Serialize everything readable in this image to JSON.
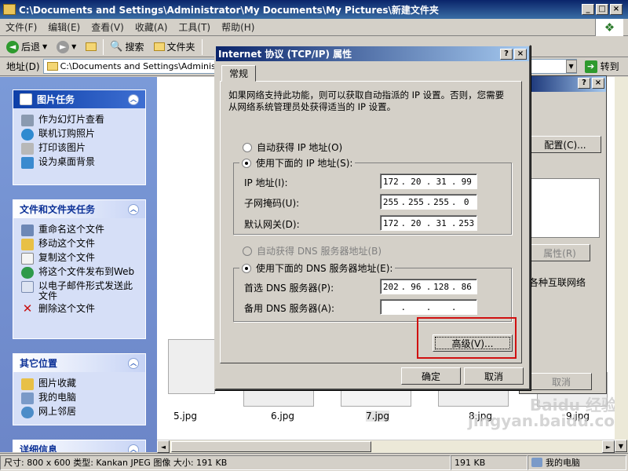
{
  "window": {
    "title": "C:\\Documents and Settings\\Administrator\\My Documents\\My Pictures\\新建文件夹"
  },
  "menu": [
    "文件(F)",
    "编辑(E)",
    "查看(V)",
    "收藏(A)",
    "工具(T)",
    "帮助(H)"
  ],
  "toolbar": {
    "back": "后退",
    "search": "搜索",
    "folders": "文件夹"
  },
  "address": {
    "label": "地址(D)",
    "value": "C:\\Documents and Settings\\Administrator",
    "go": "转到"
  },
  "left": {
    "picture_tasks": {
      "title": "图片任务",
      "items": [
        "作为幻灯片查看",
        "联机订购照片",
        "打印该图片",
        "设为桌面背景"
      ]
    },
    "file_tasks": {
      "title": "文件和文件夹任务",
      "items": [
        "重命名这个文件",
        "移动这个文件",
        "复制这个文件",
        "将这个文件发布到Web",
        "以电子邮件形式发送此文件",
        "删除这个文件"
      ]
    },
    "other_places": {
      "title": "其它位置",
      "items": [
        "图片收藏",
        "我的电脑",
        "网上邻居"
      ]
    },
    "details": {
      "title": "详细信息"
    }
  },
  "files": [
    "5.jpg",
    "6.jpg",
    "7.jpg",
    "8.jpg",
    "9.jpg"
  ],
  "status": {
    "info": "尺寸: 800 x 600 类型: Kankan JPEG 图像 大小: 191 KB",
    "size": "191 KB",
    "location": "我的电脑"
  },
  "back_dialog": {
    "config": "配置(C)...",
    "properties": "属性(R)",
    "text": "各种互联网络",
    "cancel": "取消"
  },
  "dialog": {
    "title": "Internet 协议 (TCP/IP) 属性",
    "tab": "常规",
    "description": "如果网络支持此功能，则可以获取自动指派的 IP 设置。否则，您需要从网络系统管理员处获得适当的 IP 设置。",
    "auto_ip": "自动获得 IP 地址(O)",
    "manual_ip": "使用下面的 IP 地址(S):",
    "ip_label": "IP 地址(I):",
    "ip": [
      "172",
      "20",
      "31",
      "99"
    ],
    "mask_label": "子网掩码(U):",
    "mask": [
      "255",
      "255",
      "255",
      "0"
    ],
    "gateway_label": "默认网关(D):",
    "gateway": [
      "172",
      "20",
      "31",
      "253"
    ],
    "auto_dns": "自动获得 DNS 服务器地址(B)",
    "manual_dns": "使用下面的 DNS 服务器地址(E):",
    "pref_dns_label": "首选 DNS 服务器(P):",
    "pref_dns": [
      "202",
      "96",
      "128",
      "86"
    ],
    "alt_dns_label": "备用 DNS 服务器(A):",
    "alt_dns": [
      "",
      "",
      "",
      ""
    ],
    "advanced": "高级(V)...",
    "ok": "确定",
    "cancel": "取消"
  },
  "watermark": "Baidu 经验 jingyan.baidu.com"
}
